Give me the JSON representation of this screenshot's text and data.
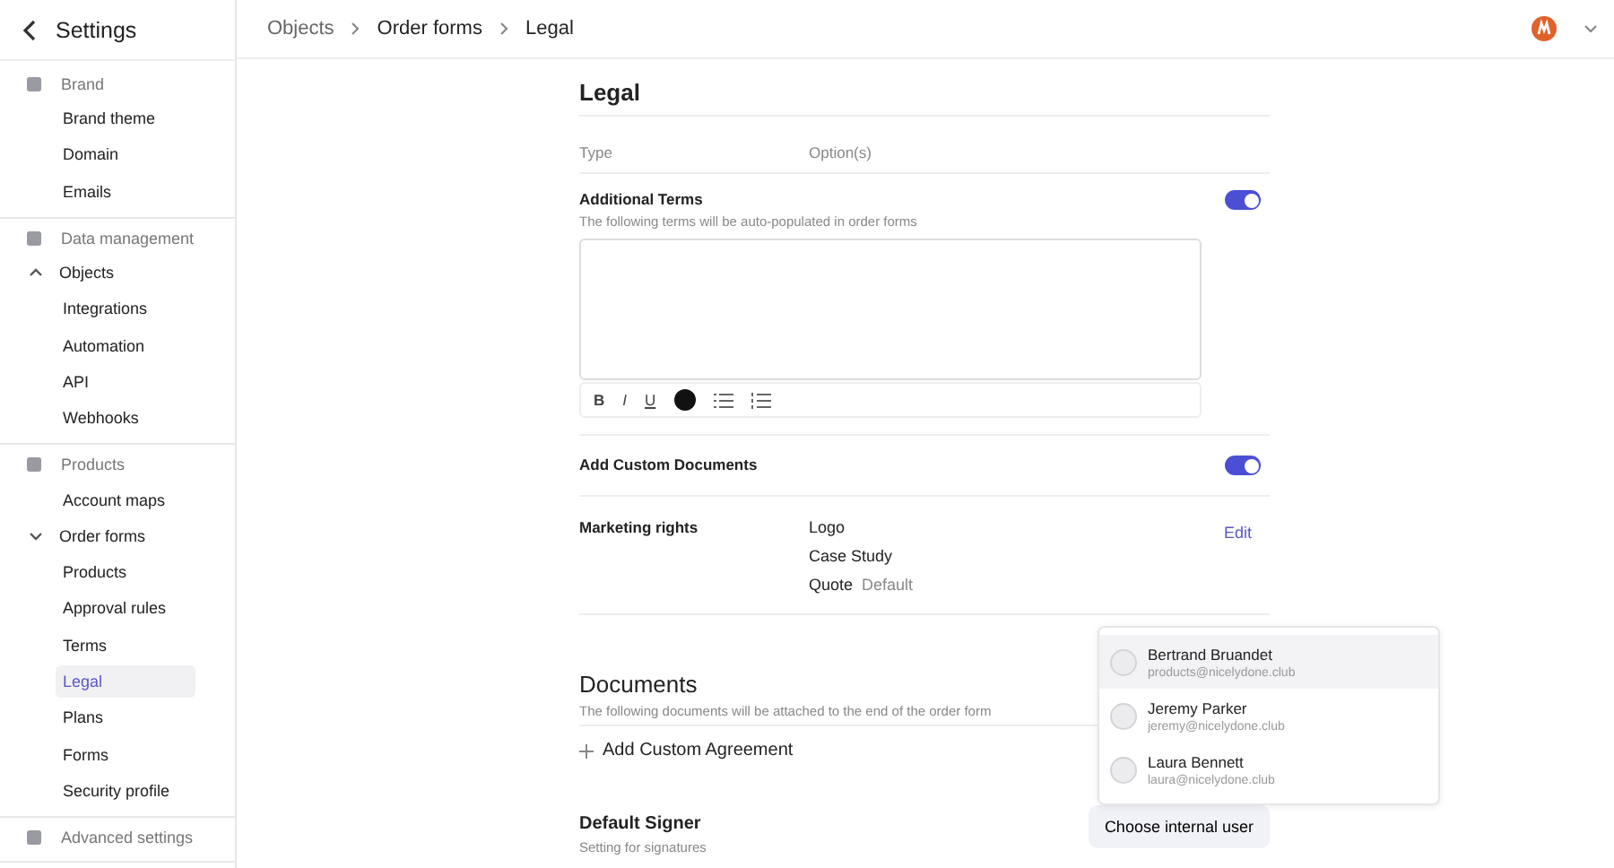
{
  "header": {
    "back_label": "Settings",
    "breadcrumbs": [
      "Objects",
      "Order forms",
      "Legal"
    ]
  },
  "sidebar": {
    "sections": [
      {
        "title": "Brand",
        "items": [
          {
            "label": "Brand theme",
            "selected": false
          },
          {
            "label": "Domain",
            "selected": false
          },
          {
            "label": "Emails",
            "selected": false
          }
        ]
      },
      {
        "title": "Data management",
        "items": [
          {
            "label": "Objects",
            "selected": false,
            "expanded": false
          },
          {
            "label": "Integrations",
            "selected": false
          },
          {
            "label": "Automation",
            "selected": false
          },
          {
            "label": "API",
            "selected": false
          },
          {
            "label": "Webhooks",
            "selected": false
          }
        ]
      },
      {
        "title": "Products",
        "items": [
          {
            "label": "Account maps",
            "selected": false
          },
          {
            "label": "Order forms",
            "selected": false,
            "expanded": true,
            "children": [
              {
                "label": "Products",
                "selected": false
              },
              {
                "label": "Approval rules",
                "selected": false
              },
              {
                "label": "Terms",
                "selected": false
              },
              {
                "label": "Legal",
                "selected": true
              }
            ]
          },
          {
            "label": "Plans",
            "selected": false
          },
          {
            "label": "Forms",
            "selected": false
          },
          {
            "label": "Security profile",
            "selected": false
          }
        ]
      },
      {
        "title": "Advanced settings"
      }
    ]
  },
  "page": {
    "title": "Legal",
    "columns": [
      "Type",
      "Option(s)"
    ],
    "additional_terms": {
      "title": "Additional Terms",
      "description": "The following terms will be auto-populated in order forms",
      "on": true,
      "format_buttons": [
        "B",
        "I",
        "U"
      ]
    },
    "custom_documents": {
      "title": "Add Custom Documents",
      "on": true
    },
    "marketing_rights": {
      "title": "Marketing rights",
      "options": [
        {
          "label": "Logo"
        },
        {
          "label": "Case Study"
        },
        {
          "label": "Quote",
          "note": "Default"
        }
      ],
      "action": "Edit"
    },
    "documents": {
      "title": "Documents",
      "description": "The following documents will be attached to the end of the order form",
      "add_label": "Add Custom Agreement"
    },
    "default_signer": {
      "title": "Default Signer",
      "description": "Setting for signatures",
      "button": "Choose internal user"
    }
  },
  "user_menu": [
    {
      "name": "Bertrand Bruandet",
      "email": "products@nicelydone.club",
      "selected": true
    },
    {
      "name": "Jeremy Parker",
      "email": "jeremy@nicelydone.club",
      "selected": false
    },
    {
      "name": "Laura Bennett",
      "email": "laura@nicelydone.club",
      "selected": false
    }
  ]
}
